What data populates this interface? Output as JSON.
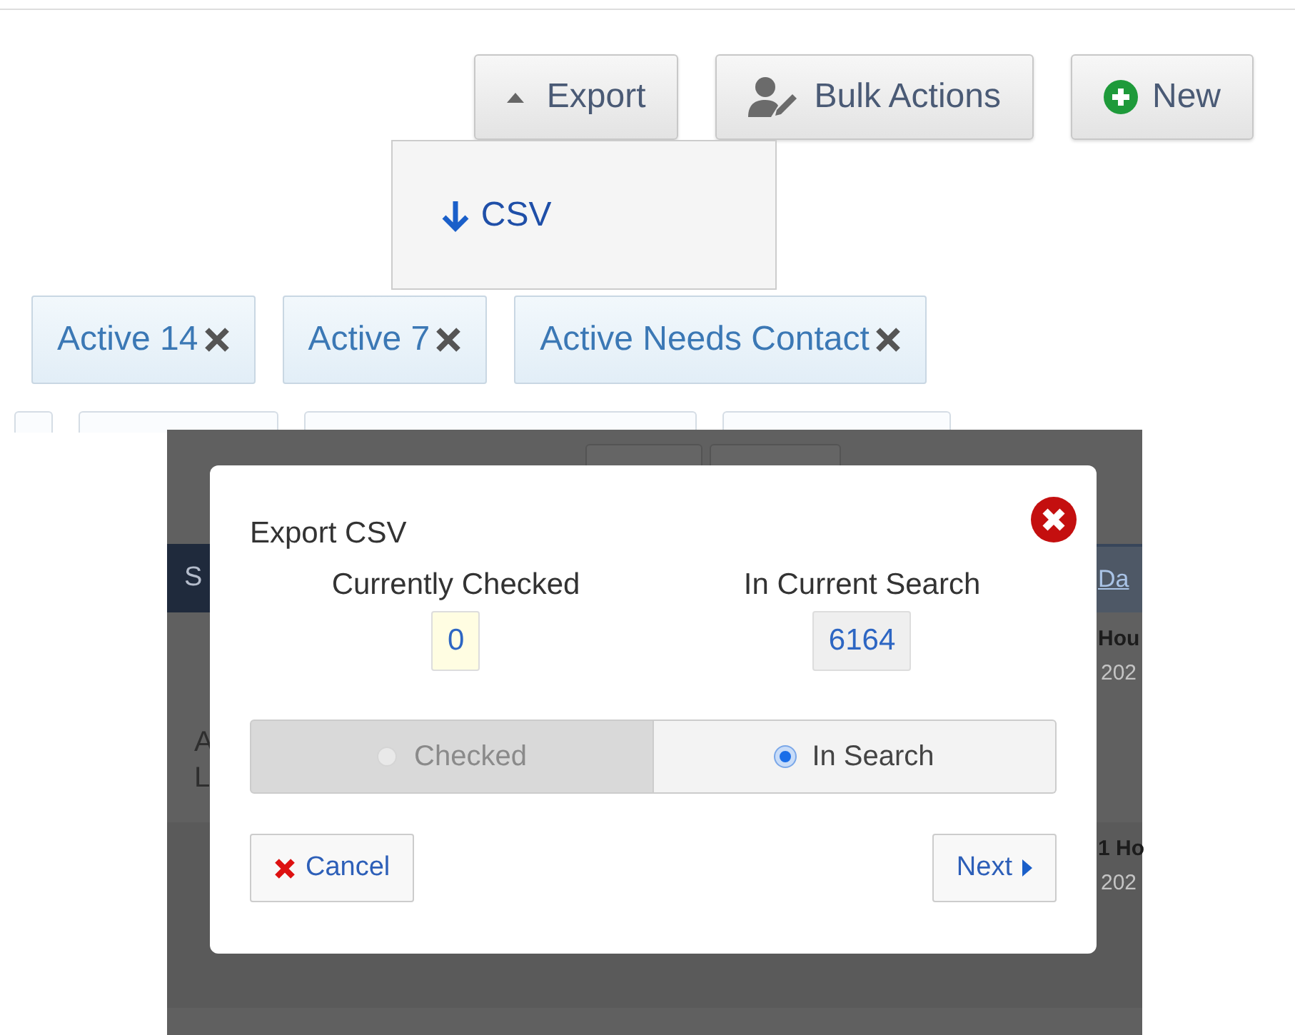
{
  "toolbar": {
    "buttons": [
      {
        "kind": "dropdown",
        "label": "Export",
        "expanded": true
      },
      {
        "kind": "bulk",
        "label": "Bulk Actions"
      },
      {
        "kind": "new",
        "label": "New"
      }
    ]
  },
  "export_menu": {
    "items": [
      {
        "label": "CSV"
      }
    ]
  },
  "filters": [
    {
      "label": "Active 14"
    },
    {
      "label": "Active 7"
    },
    {
      "label": "Active Needs Contact"
    }
  ],
  "background_table": {
    "header_left": "S",
    "header_right": "Da",
    "left_cells": [
      "A",
      "L"
    ],
    "right_cells": [
      {
        "title": "Hou",
        "date": "202"
      },
      {
        "title": "1 Ho",
        "date": "202"
      }
    ]
  },
  "modal": {
    "title": "Export CSV",
    "counts": [
      {
        "kind": "checked",
        "label": "Currently Checked",
        "value": "0"
      },
      {
        "kind": "search",
        "label": "In Current Search",
        "value": "6164"
      }
    ],
    "options": [
      {
        "label": "Checked",
        "selected": false
      },
      {
        "label": "In Search",
        "selected": true
      }
    ],
    "cancel": "Cancel",
    "next": "Next"
  }
}
